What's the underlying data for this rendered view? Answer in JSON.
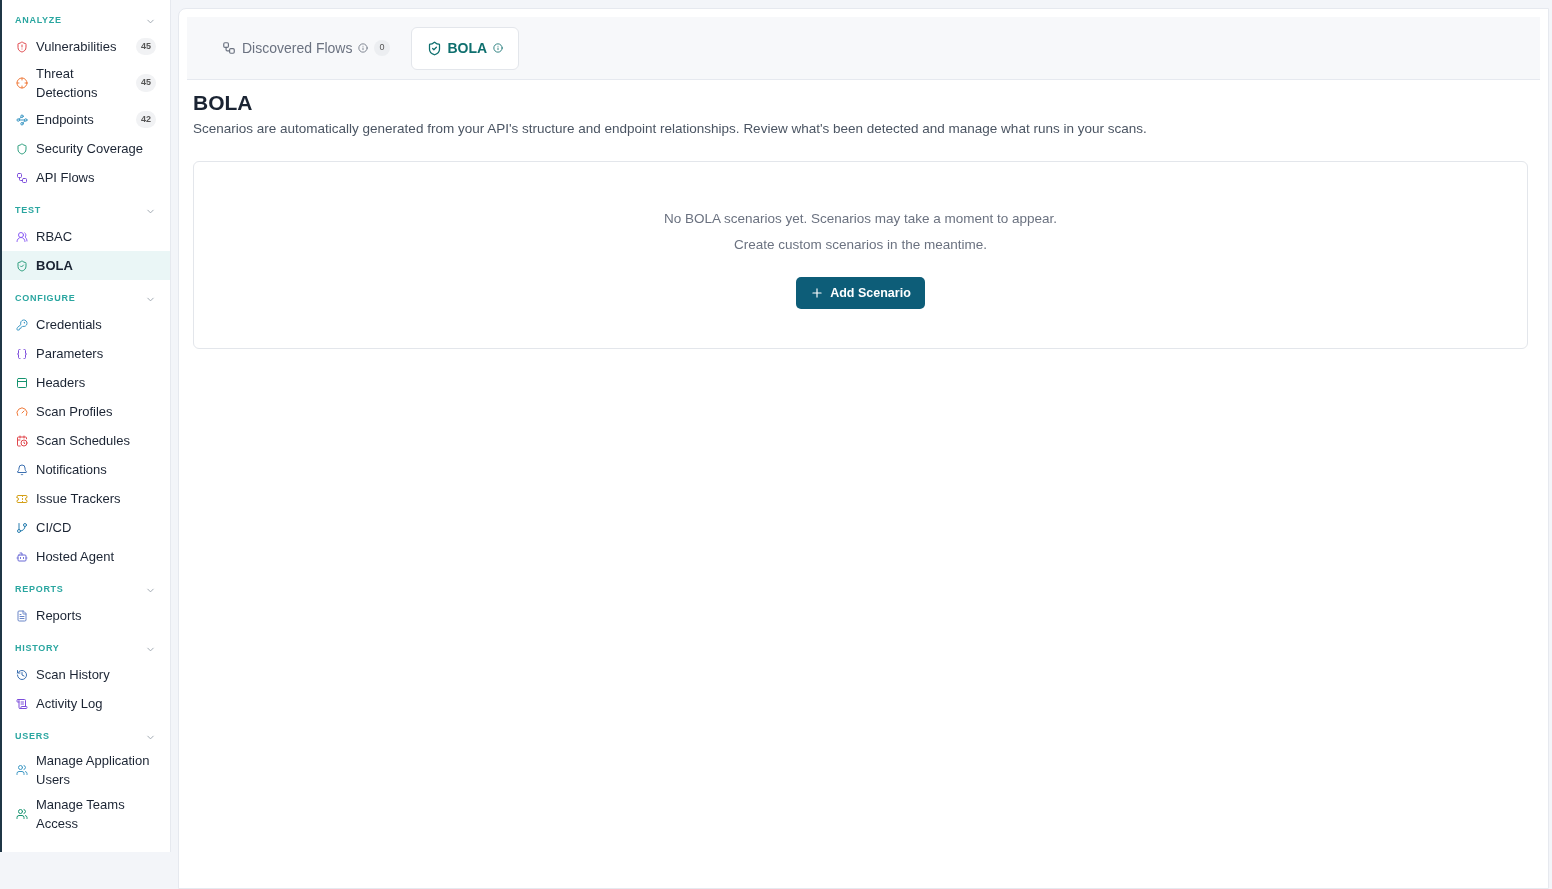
{
  "sidebar": {
    "sections": [
      {
        "title": "ANALYZE",
        "expanded": true,
        "items": [
          {
            "label": "Vulnerabilities",
            "count": "45",
            "selected": false
          },
          {
            "label": "Threat Detections",
            "count": "45",
            "selected": false
          },
          {
            "label": "Endpoints",
            "count": "42",
            "selected": false
          },
          {
            "label": "Security Coverage",
            "selected": false
          },
          {
            "label": "API Flows",
            "selected": false
          }
        ]
      },
      {
        "title": "TEST",
        "expanded": true,
        "items": [
          {
            "label": "RBAC",
            "selected": false
          },
          {
            "label": "BOLA",
            "selected": true
          }
        ]
      },
      {
        "title": "CONFIGURE",
        "expanded": true,
        "items": [
          {
            "label": "Credentials",
            "selected": false
          },
          {
            "label": "Parameters",
            "selected": false
          },
          {
            "label": "Headers",
            "selected": false
          },
          {
            "label": "Scan Profiles",
            "selected": false
          },
          {
            "label": "Scan Schedules",
            "selected": false
          },
          {
            "label": "Notifications",
            "selected": false
          },
          {
            "label": "Issue Trackers",
            "selected": false
          },
          {
            "label": "CI/CD",
            "selected": false
          },
          {
            "label": "Hosted Agent",
            "selected": false
          }
        ]
      },
      {
        "title": "REPORTS",
        "expanded": true,
        "items": [
          {
            "label": "Reports",
            "selected": false
          }
        ]
      },
      {
        "title": "HISTORY",
        "expanded": true,
        "items": [
          {
            "label": "Scan History",
            "selected": false
          },
          {
            "label": "Activity Log",
            "selected": false
          }
        ]
      },
      {
        "title": "USERS",
        "expanded": true,
        "items": [
          {
            "label": "Manage Application Users",
            "selected": false
          },
          {
            "label": "Manage Teams Access",
            "selected": false
          }
        ]
      }
    ]
  },
  "tabs": [
    {
      "label": "Discovered Flows",
      "count": "0",
      "selected": false
    },
    {
      "label": "BOLA",
      "selected": true
    }
  ],
  "page": {
    "title": "BOLA",
    "description": "Scenarios are automatically generated from your API's structure and endpoint relationships. Review what's been detected and manage what runs in your scans.",
    "empty_state": {
      "lines": [
        "No BOLA scenarios yet. Scenarios may take a moment to appear.",
        "Create custom scenarios in the meantime."
      ],
      "button": "Add Scenario"
    }
  }
}
